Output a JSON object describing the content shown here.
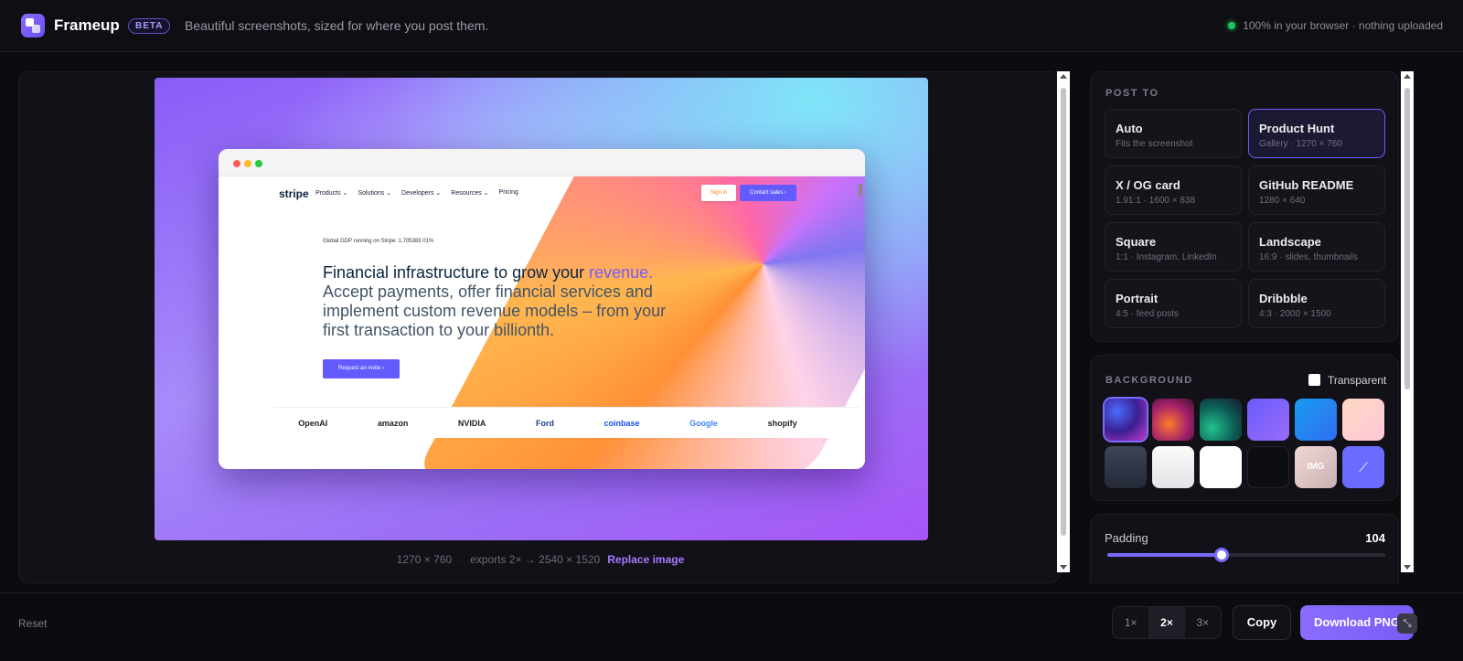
{
  "header": {
    "brand": "Frameup",
    "badge": "BETA",
    "tagline": "Beautiful screenshots, sized for where you post them.",
    "privacy": "100% in your browser · nothing uploaded"
  },
  "preview": {
    "site": {
      "logo": "stripe",
      "nav": [
        "Products ⌄",
        "Solutions ⌄",
        "Developers ⌄",
        "Resources ⌄",
        "Pricing"
      ],
      "signin": "Sign in",
      "contact": "Contact sales ›",
      "gdp": "Global GDP running on Stripe: 1.705383 01%",
      "hero_main": "Financial infrastructure to grow your ",
      "hero_accent": "revenue.",
      "hero_sub": "Accept payments, offer financial services and implement custom revenue models – from your first transaction to your billionth.",
      "cta": "Request an invite ›",
      "logos": [
        "OpenAI",
        "amazon",
        "NVIDIA",
        "Ford",
        "coinbase",
        "Google",
        "shopify"
      ]
    },
    "dims": "1270 × 760",
    "export": "exports 2× → 2540 × 1520",
    "replace": "Replace image"
  },
  "post_to": {
    "title": "POST TO",
    "options": [
      {
        "title": "Auto",
        "sub": "Fits the screenshot"
      },
      {
        "title": "Product Hunt",
        "sub": "Gallery · 1270 × 760",
        "selected": true
      },
      {
        "title": "X / OG card",
        "sub": "1.91:1 · 1600 × 838"
      },
      {
        "title": "GitHub README",
        "sub": "1280 × 640"
      },
      {
        "title": "Square",
        "sub": "1:1 · Instagram, LinkedIn"
      },
      {
        "title": "Landscape",
        "sub": "16:9 · slides, thumbnails"
      },
      {
        "title": "Portrait",
        "sub": "4:5 · feed posts"
      },
      {
        "title": "Dribbble",
        "sub": "4:3 · 2000 × 1500"
      }
    ]
  },
  "background": {
    "title": "BACKGROUND",
    "transparent_label": "Transparent",
    "transparent_checked": false,
    "swatch_img_label": "IMG",
    "swatch_custom_label": "⟋"
  },
  "padding": {
    "label": "Padding",
    "value": "104",
    "fraction": 0.41
  },
  "footer": {
    "reset": "Reset",
    "scales": [
      "1×",
      "2×",
      "3×"
    ],
    "scale_selected": "2×",
    "copy": "Copy",
    "download": "Download PNG",
    "mini": "⤡"
  },
  "colors": {
    "accent": "#7a6bff",
    "status_dot": "#22c55e"
  }
}
